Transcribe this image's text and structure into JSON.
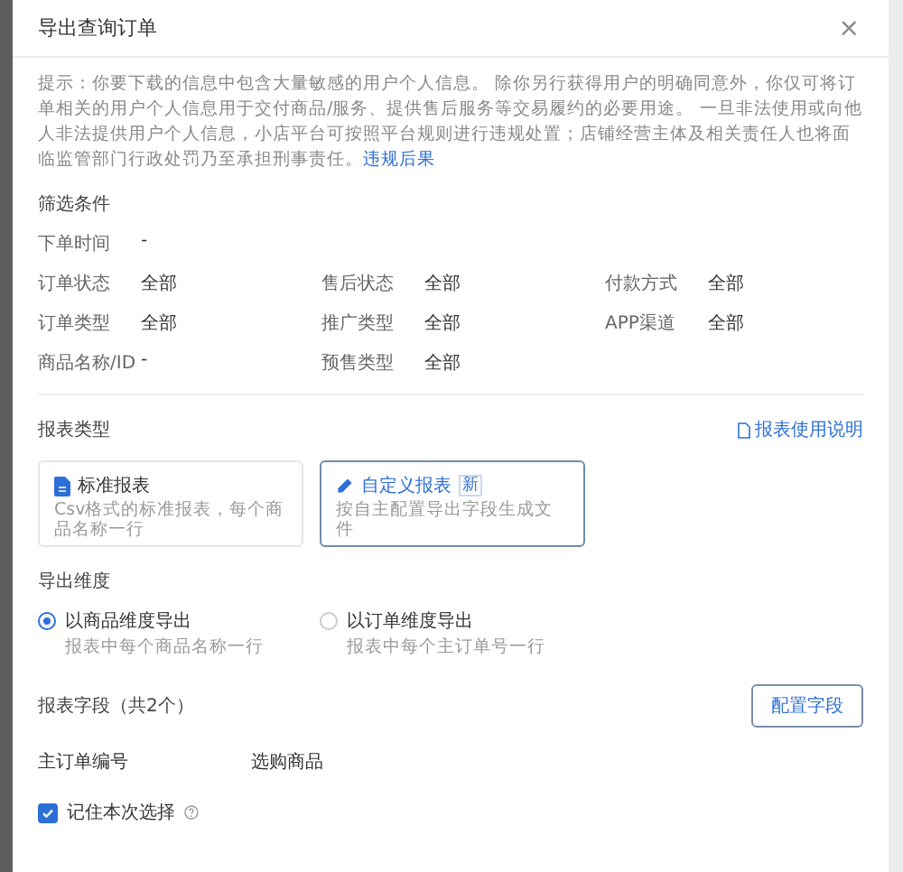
{
  "dialog": {
    "title": "导出查询订单",
    "close": "×"
  },
  "notice": {
    "text": "提示：你要下载的信息中包含大量敏感的用户个人信息。 除你另行获得用户的明确同意外，你仅可将订单相关的用户个人信息用于交付商品/服务、提供售后服务等交易履约的必要用途。 一旦非法使用或向他人非法提供用户个人信息，小店平台可按照平台规则进行违规处置；店铺经营主体及相关责任人也将面临监管部门行政处罚乃至承担刑事责任。",
    "link": "违规后果"
  },
  "filter": {
    "title": "筛选条件",
    "rows": [
      [
        {
          "label": "下单时间",
          "value": "-"
        }
      ],
      [
        {
          "label": "订单状态",
          "value": "全部"
        },
        {
          "label": "售后状态",
          "value": "全部"
        },
        {
          "label": "付款方式",
          "value": "全部"
        }
      ],
      [
        {
          "label": "订单类型",
          "value": "全部"
        },
        {
          "label": "推广类型",
          "value": "全部"
        },
        {
          "label": "APP渠道",
          "value": "全部"
        }
      ],
      [
        {
          "label": "商品名称/ID",
          "value": "-"
        },
        {
          "label": "预售类型",
          "value": "全部"
        }
      ]
    ]
  },
  "report_type": {
    "title": "报表类型",
    "help_link": "报表使用说明",
    "options": [
      {
        "kind": "standard",
        "title": "标准报表",
        "description": "Csv格式的标准报表，每个商品名称一行",
        "selected": false
      },
      {
        "kind": "custom",
        "title": "自定义报表",
        "badge": "新",
        "description": "按自主配置导出字段生成文件",
        "selected": true
      }
    ]
  },
  "dimension": {
    "title": "导出维度",
    "options": [
      {
        "label": "以商品维度导出",
        "description": "报表中每个商品名称一行",
        "selected": true
      },
      {
        "label": "以订单维度导出",
        "description": "报表中每个主订单号一行",
        "selected": false
      }
    ]
  },
  "fields": {
    "title": "报表字段（共2个）",
    "button": "配置字段",
    "items": [
      "主订单编号",
      "选购商品"
    ]
  },
  "remember": {
    "label": "记住本次选择",
    "checked": true
  }
}
